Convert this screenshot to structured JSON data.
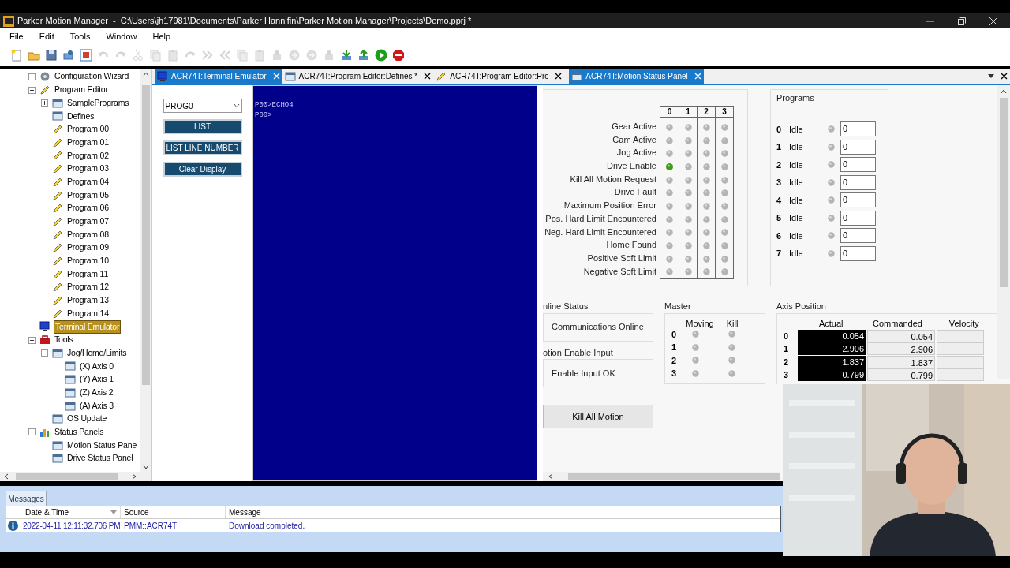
{
  "window": {
    "title": "Parker Motion Manager  -  C:\\Users\\jh17981\\Documents\\Parker Hannifin\\Parker Motion Manager\\Projects\\Demo.pprj *"
  },
  "menu": [
    "File",
    "Edit",
    "Tools",
    "Window",
    "Help"
  ],
  "toolbar": [
    {
      "kind": "new",
      "disabled": false
    },
    {
      "kind": "open",
      "disabled": false
    },
    {
      "kind": "save",
      "disabled": false
    },
    {
      "kind": "connect",
      "disabled": false
    },
    {
      "kind": "terminal",
      "disabled": false
    },
    {
      "kind": "undo",
      "disabled": true
    },
    {
      "kind": "redo",
      "disabled": true
    },
    {
      "kind": "cut",
      "disabled": true
    },
    {
      "kind": "copy",
      "disabled": true
    },
    {
      "kind": "paste",
      "disabled": true
    },
    {
      "kind": "redo",
      "disabled": true
    },
    {
      "kind": "forward",
      "disabled": true
    },
    {
      "kind": "back",
      "disabled": true
    },
    {
      "kind": "copy",
      "disabled": true
    },
    {
      "kind": "paste",
      "disabled": true
    },
    {
      "kind": "tool",
      "disabled": true
    },
    {
      "kind": "circle",
      "disabled": true
    },
    {
      "kind": "circle",
      "disabled": true
    },
    {
      "kind": "tool",
      "disabled": true
    },
    {
      "kind": "download",
      "disabled": false
    },
    {
      "kind": "upload",
      "disabled": false
    },
    {
      "kind": "run",
      "disabled": false
    },
    {
      "kind": "stop",
      "disabled": false
    }
  ],
  "tree": [
    {
      "label": "Configuration Wizard",
      "kind": "gear",
      "expanded": false,
      "selected": false
    },
    {
      "label": "Program Editor",
      "kind": "pencil",
      "expanded": true,
      "selected": false,
      "children": [
        {
          "label": "SamplePrograms",
          "kind": "window",
          "expanded": false,
          "selected": false
        },
        {
          "label": "Defines",
          "kind": "window",
          "selected": false
        },
        {
          "label": "Program 00",
          "kind": "pencil",
          "selected": false
        },
        {
          "label": "Program 01",
          "kind": "pencil",
          "selected": false
        },
        {
          "label": "Program 02",
          "kind": "pencil",
          "selected": false
        },
        {
          "label": "Program 03",
          "kind": "pencil",
          "selected": false
        },
        {
          "label": "Program 04",
          "kind": "pencil",
          "selected": false
        },
        {
          "label": "Program 05",
          "kind": "pencil",
          "selected": false
        },
        {
          "label": "Program 06",
          "kind": "pencil",
          "selected": false
        },
        {
          "label": "Program 07",
          "kind": "pencil",
          "selected": false
        },
        {
          "label": "Program 08",
          "kind": "pencil",
          "selected": false
        },
        {
          "label": "Program 09",
          "kind": "pencil",
          "selected": false
        },
        {
          "label": "Program 10",
          "kind": "pencil",
          "selected": false
        },
        {
          "label": "Program 11",
          "kind": "pencil",
          "selected": false
        },
        {
          "label": "Program 12",
          "kind": "pencil",
          "selected": false
        },
        {
          "label": "Program 13",
          "kind": "pencil",
          "selected": false
        },
        {
          "label": "Program 14",
          "kind": "pencil",
          "selected": false
        }
      ]
    },
    {
      "label": "Terminal Emulator",
      "kind": "monitor",
      "selected": true
    },
    {
      "label": "Tools",
      "kind": "toolbox",
      "expanded": true,
      "selected": false,
      "children": [
        {
          "label": "Jog/Home/Limits",
          "kind": "window",
          "expanded": true,
          "selected": false,
          "children": [
            {
              "label": "(X) Axis 0",
              "kind": "window",
              "selected": false
            },
            {
              "label": "(Y) Axis 1",
              "kind": "window",
              "selected": false
            },
            {
              "label": "(Z) Axis 2",
              "kind": "window",
              "selected": false
            },
            {
              "label": "(A) Axis 3",
              "kind": "window",
              "selected": false
            }
          ]
        },
        {
          "label": "OS Update",
          "kind": "window",
          "selected": false
        }
      ]
    },
    {
      "label": "Status Panels",
      "kind": "chart",
      "expanded": true,
      "selected": false,
      "children": [
        {
          "label": "Motion Status Pane",
          "kind": "window",
          "selected": false
        },
        {
          "label": "Drive Status Panel",
          "kind": "window",
          "selected": false
        }
      ]
    }
  ],
  "tabs": [
    {
      "label": "ACR74T:Terminal Emulator",
      "kind": "monitor",
      "selected": true
    },
    {
      "label": "ACR74T:Program Editor:Defines *",
      "kind": "window",
      "selected": false
    },
    {
      "label": "ACR74T:Program Editor:Prc",
      "kind": "pencil",
      "selected": false
    },
    {
      "label": "ACR74T:Motion Status Panel",
      "kind": "window",
      "selected": true
    }
  ],
  "terminal": {
    "program_select": "PROG0",
    "buttons": [
      "LIST",
      "LIST LINE NUMBER",
      "Clear Display"
    ],
    "lines": [
      "P00>ECHO4",
      "P00>"
    ]
  },
  "status_panel": {
    "axis_headers": [
      "0",
      "1",
      "2",
      "3"
    ],
    "flags": [
      {
        "label": "Gear Active",
        "axes": [
          false,
          false,
          false,
          false
        ]
      },
      {
        "label": "Cam Active",
        "axes": [
          false,
          false,
          false,
          false
        ]
      },
      {
        "label": "Jog Active",
        "axes": [
          false,
          false,
          false,
          false
        ]
      },
      {
        "label": "Drive Enable",
        "axes": [
          true,
          false,
          false,
          false
        ]
      },
      {
        "label": "Kill All Motion Request",
        "axes": [
          false,
          false,
          false,
          false
        ]
      },
      {
        "label": "Drive Fault",
        "axes": [
          false,
          false,
          false,
          false
        ]
      },
      {
        "label": "Maximum Position Error",
        "axes": [
          false,
          false,
          false,
          false
        ]
      },
      {
        "label": "Pos. Hard Limit Encountered",
        "axes": [
          false,
          false,
          false,
          false
        ]
      },
      {
        "label": "Neg. Hard Limit Encountered",
        "axes": [
          false,
          false,
          false,
          false
        ]
      },
      {
        "label": "Home Found",
        "axes": [
          false,
          false,
          false,
          false
        ]
      },
      {
        "label": "Positive Soft Limit",
        "axes": [
          false,
          false,
          false,
          false
        ]
      },
      {
        "label": "Negative Soft Limit",
        "axes": [
          false,
          false,
          false,
          false
        ]
      }
    ],
    "programs": {
      "title": "Programs",
      "rows": [
        {
          "number": "0",
          "state": "Idle",
          "active": false,
          "value": "0"
        },
        {
          "number": "1",
          "state": "Idle",
          "active": false,
          "value": "0"
        },
        {
          "number": "2",
          "state": "Idle",
          "active": false,
          "value": "0"
        },
        {
          "number": "3",
          "state": "Idle",
          "active": false,
          "value": "0"
        },
        {
          "number": "4",
          "state": "Idle",
          "active": false,
          "value": "0"
        },
        {
          "number": "5",
          "state": "Idle",
          "active": false,
          "value": "0"
        },
        {
          "number": "6",
          "state": "Idle",
          "active": false,
          "value": "0"
        },
        {
          "number": "7",
          "state": "Idle",
          "active": false,
          "value": "0"
        }
      ]
    },
    "online_status": {
      "title": "nline Status",
      "text": "Communications Online"
    },
    "motion_enable": {
      "title": "otion Enable Input",
      "text": "Enable Input OK"
    },
    "master": {
      "title": "Master",
      "columns": [
        "Moving",
        "Kill"
      ],
      "rows": [
        {
          "number": "0",
          "moving": false,
          "kill": false
        },
        {
          "number": "1",
          "moving": false,
          "kill": false
        },
        {
          "number": "2",
          "moving": false,
          "kill": false
        },
        {
          "number": "3",
          "moving": false,
          "kill": false
        }
      ]
    },
    "axis_position": {
      "title": "Axis Position",
      "columns": [
        "Actual",
        "Commanded",
        "Velocity"
      ],
      "rows": [
        {
          "axis": "0",
          "actual": "0.054",
          "commanded": "0.054"
        },
        {
          "axis": "1",
          "actual": "2.906",
          "commanded": "2.906"
        },
        {
          "axis": "2",
          "actual": "1.837",
          "commanded": "1.837"
        },
        {
          "axis": "3",
          "actual": "0.799",
          "commanded": "0.799"
        }
      ]
    },
    "kill_button": "Kill All Motion"
  },
  "messages": {
    "tab": "Messages",
    "columns": [
      "Date & Time",
      "Source",
      "Message"
    ],
    "rows": [
      {
        "kind": "info",
        "date": "2022-04-11 12:11:32.706 PM",
        "source": "PMM::ACR74T",
        "message": "Download completed."
      }
    ]
  }
}
